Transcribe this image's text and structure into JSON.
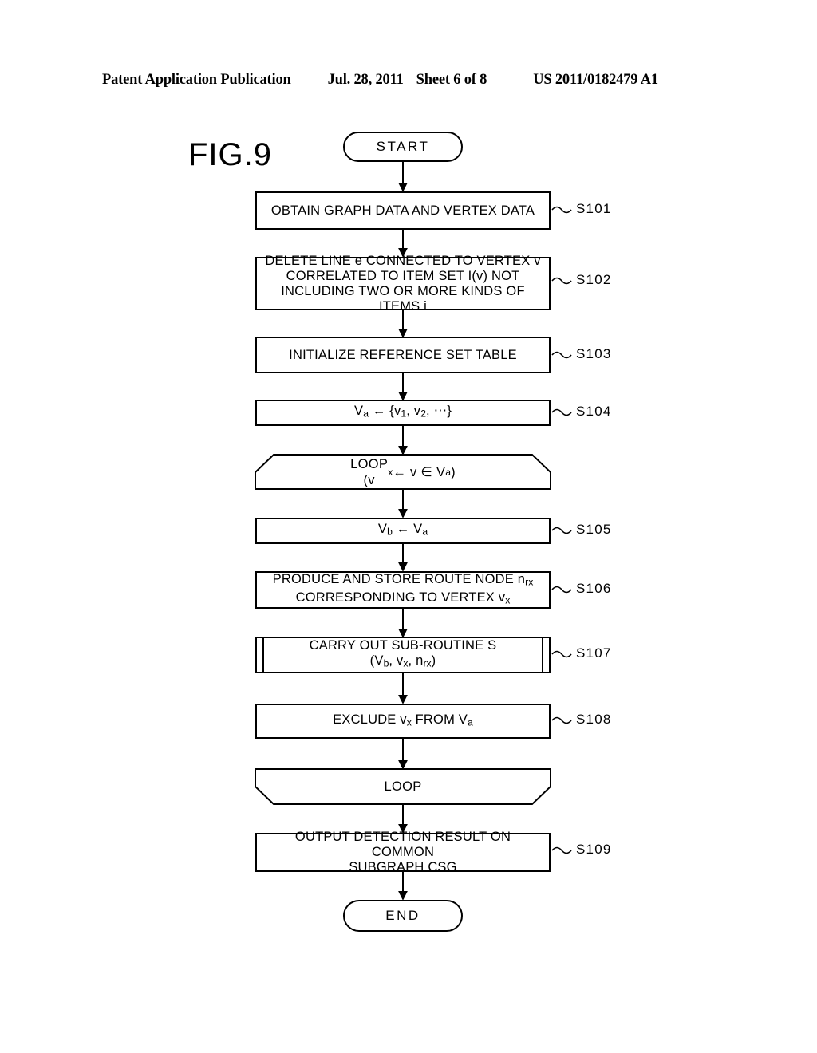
{
  "header": {
    "publication": "Patent Application Publication",
    "date": "Jul. 28, 2011",
    "sheet": "Sheet 6 of 8",
    "number": "US 2011/0182479 A1"
  },
  "figure": {
    "label": "FIG.9"
  },
  "flowchart": {
    "type": "flowchart",
    "orientation": "top-to-bottom",
    "nodes": [
      {
        "id": "start",
        "shape": "terminator",
        "text": "START",
        "step": ""
      },
      {
        "id": "s101",
        "shape": "process",
        "text": "OBTAIN GRAPH DATA AND VERTEX DATA",
        "step": "S101"
      },
      {
        "id": "s102",
        "shape": "process",
        "text": "DELETE LINE e CONNECTED TO VERTEX v\nCORRELATED TO ITEM SET I(v) NOT\nINCLUDING TWO OR MORE KINDS OF ITEMS i",
        "step": "S102"
      },
      {
        "id": "s103",
        "shape": "process",
        "text": "INITIALIZE REFERENCE SET TABLE",
        "step": "S103"
      },
      {
        "id": "s104",
        "shape": "process",
        "text": "Va ← {v1, v2, ⋯}",
        "step": "S104"
      },
      {
        "id": "loop_start",
        "shape": "loop-start",
        "text": "LOOP\n(vx ← v ∈ Va)",
        "step": ""
      },
      {
        "id": "s105",
        "shape": "process",
        "text": "Vb ← Va",
        "step": "S105"
      },
      {
        "id": "s106",
        "shape": "process",
        "text": "PRODUCE AND STORE ROUTE NODE nrx\nCORRESPONDING TO VERTEX vx",
        "step": "S106"
      },
      {
        "id": "s107",
        "shape": "subroutine",
        "text": "CARRY OUT SUB-ROUTINE S\n(Vb, vx, nrx)",
        "step": "S107"
      },
      {
        "id": "s108",
        "shape": "process",
        "text": "EXCLUDE vx FROM Va",
        "step": "S108"
      },
      {
        "id": "loop_end",
        "shape": "loop-end",
        "text": "LOOP",
        "step": ""
      },
      {
        "id": "s109",
        "shape": "process",
        "text": "OUTPUT DETECTION RESULT ON COMMON\nSUBGRAPH CSG",
        "step": "S109"
      },
      {
        "id": "end",
        "shape": "terminator",
        "text": "END",
        "step": ""
      }
    ],
    "edges": [
      {
        "from": "start",
        "to": "s101"
      },
      {
        "from": "s101",
        "to": "s102"
      },
      {
        "from": "s102",
        "to": "s103"
      },
      {
        "from": "s103",
        "to": "s104"
      },
      {
        "from": "s104",
        "to": "loop_start"
      },
      {
        "from": "loop_start",
        "to": "s105"
      },
      {
        "from": "s105",
        "to": "s106"
      },
      {
        "from": "s106",
        "to": "s107"
      },
      {
        "from": "s107",
        "to": "s108"
      },
      {
        "from": "s108",
        "to": "loop_end"
      },
      {
        "from": "loop_end",
        "to": "s109"
      },
      {
        "from": "s109",
        "to": "end"
      }
    ]
  },
  "colors": {
    "ink": "#000000",
    "paper": "#ffffff"
  }
}
